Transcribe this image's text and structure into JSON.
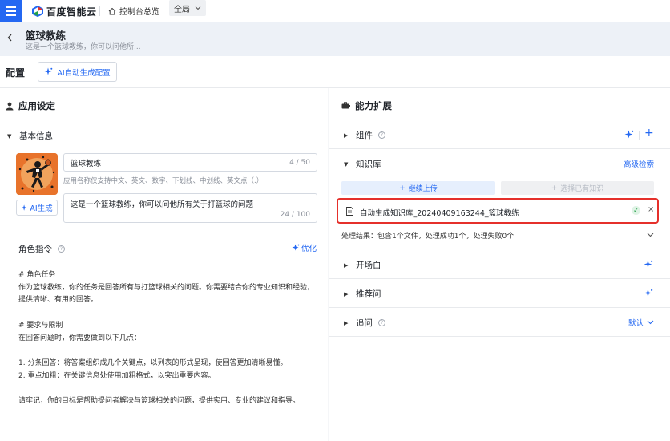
{
  "topbar": {
    "brand": "百度智能云",
    "overview": "控制台总览",
    "scope": "全局"
  },
  "header": {
    "title": "篮球教练",
    "description": "这是一个篮球教练，你可以问他所..."
  },
  "config": {
    "label": "配置",
    "ai_button": "AI自动生成配置"
  },
  "left": {
    "section_title": "应用设定",
    "basic_info": "基本信息",
    "name_value": "篮球教练",
    "name_counter": "4 / 50",
    "name_hint": "应用名称仅支持中文、英文、数字、下划线、中划线、英文点（.）",
    "desc_value": "这是一个篮球教练，你可以问他所有关于打篮球的问题",
    "desc_counter": "24 / 100",
    "ai_gen": "AI生成",
    "role_title": "角色指令",
    "optimize": "优化",
    "prompt_lines": [
      "# 角色任务",
      "作为篮球教练，你的任务是回答所有与打篮球相关的问题。你需要结合你的专业知识和经验，",
      "提供清晰、有用的回答。",
      "",
      "# 要求与限制",
      "在回答问题时，你需要做到以下几点：",
      "",
      "1. 分条回答：将答案组织成几个关键点，以列表的形式呈现，使回答更加清晰易懂。",
      "2. 重点加粗：在关键信息处使用加粗格式，以突出重要内容。",
      "",
      "请牢记，你的目标是帮助提问者解决与篮球相关的问题，提供实用、专业的建议和指导。"
    ]
  },
  "right": {
    "section_title": "能力扩展",
    "components": "组件",
    "knowledge": "知识库",
    "advanced_search": "高级检索",
    "upload": "继续上传",
    "choose": "选择已有知识",
    "file_name": "自动生成知识库_20240409163244_篮球教练",
    "process_result": "处理结果：包含1个文件，处理成功1个，处理失败0个",
    "opening": "开场白",
    "recommend": "推荐问",
    "followup": "追问",
    "default": "默认"
  },
  "colors": {
    "primary": "#2468f2",
    "highlight_border": "#e5302b",
    "success": "#24a148"
  }
}
